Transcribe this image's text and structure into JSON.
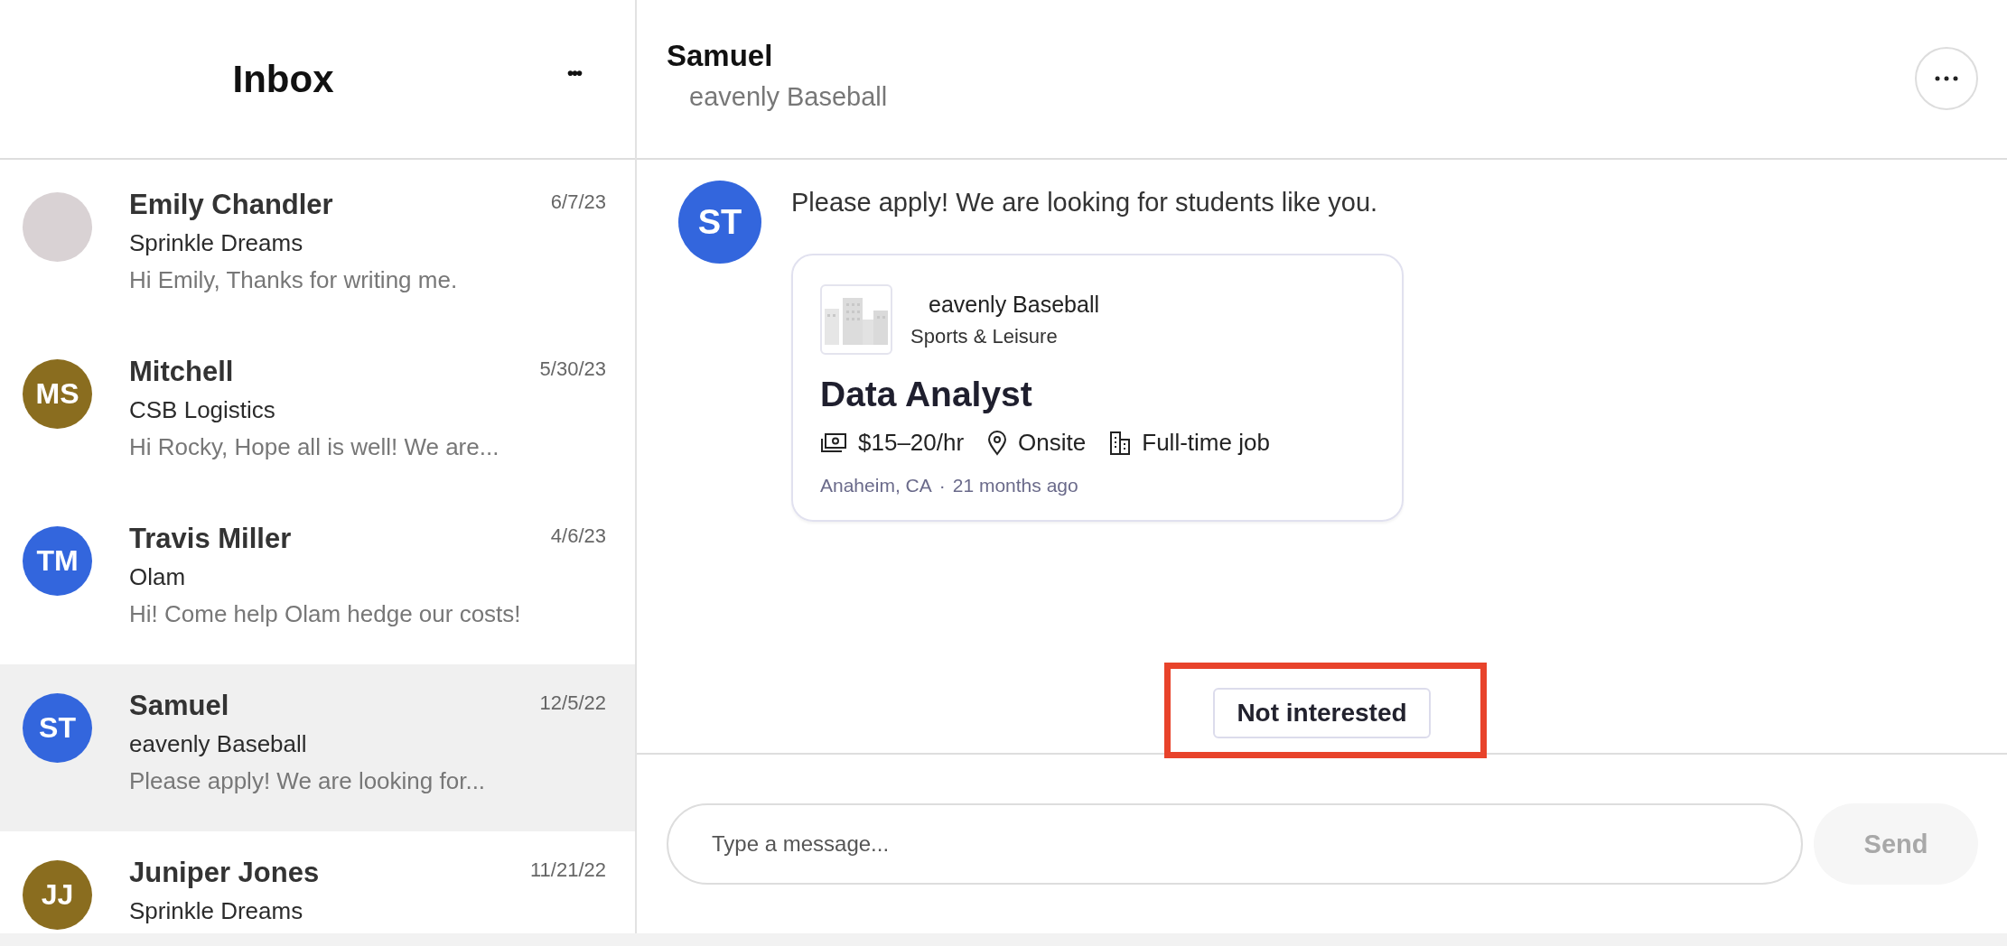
{
  "inbox": {
    "title": "Inbox",
    "more": "•••"
  },
  "conversations": [
    {
      "name": "Emily Chandler",
      "company": "Sprinkle Dreams",
      "preview": "Hi Emily, Thanks for writing me.",
      "date": "6/7/23",
      "avatar": {
        "kind": "photo"
      },
      "selected": false
    },
    {
      "name": "Mitchell",
      "company": "CSB Logistics",
      "preview": "Hi Rocky, Hope all is well! We are...",
      "date": "5/30/23",
      "avatar": {
        "kind": "initials",
        "initials": "MS",
        "color": "#8a6d1f"
      },
      "selected": false
    },
    {
      "name": "Travis Miller",
      "company": "Olam",
      "preview": "Hi! Come help Olam hedge our costs!",
      "date": "4/6/23",
      "avatar": {
        "kind": "initials",
        "initials": "TM",
        "color": "#3366dd"
      },
      "selected": false
    },
    {
      "name": "Samuel",
      "company": "eavenly Baseball",
      "preview": "Please apply! We are looking for...",
      "date": "12/5/22",
      "avatar": {
        "kind": "initials",
        "initials": "ST",
        "color": "#3366dd"
      },
      "selected": true
    },
    {
      "name": "Juniper Jones",
      "company": "Sprinkle Dreams",
      "date": "11/21/22",
      "avatar": {
        "kind": "initials",
        "initials": "JJ",
        "color": "#8a6d1f"
      },
      "selected": false
    }
  ],
  "chat": {
    "name": "Samuel",
    "subtitle": "eavenly Baseball",
    "messages": [
      {
        "avatar": {
          "initials": "ST",
          "color": "#3366dd"
        },
        "text": "Please apply! We are looking for students like you.",
        "job_card": {
          "company": "eavenly Baseball",
          "industry": "Sports & Leisure",
          "title": "Data Analyst",
          "details": [
            {
              "kind": "pay",
              "text": "$15–20/hr"
            },
            {
              "kind": "location",
              "text": "Onsite"
            },
            {
              "kind": "type",
              "text": "Full-time job"
            }
          ],
          "location": "Anaheim, CA",
          "separator": "·",
          "posted": "21 months ago"
        }
      }
    ],
    "actions": [
      {
        "label": "Not interested",
        "highlighted": true
      }
    ],
    "composer": {
      "placeholder": "Type a message...",
      "send": "Send",
      "send_disabled": true
    }
  }
}
